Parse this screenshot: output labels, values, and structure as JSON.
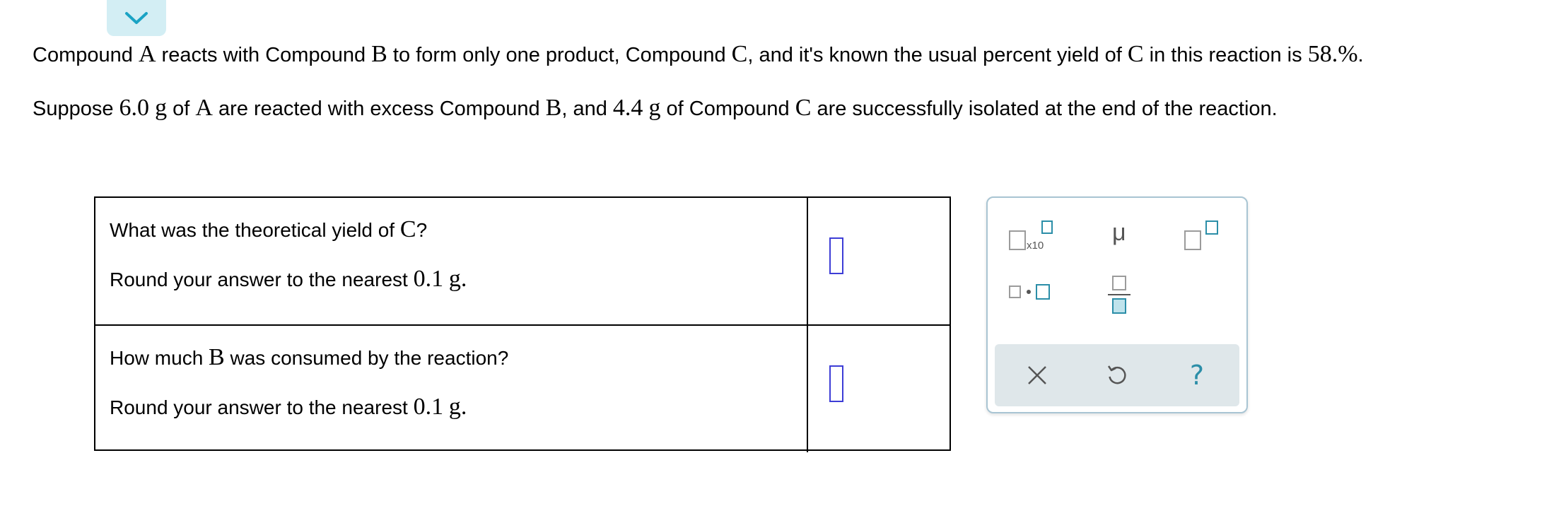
{
  "collapse_icon": "chevron-down-icon",
  "intro": {
    "line1": {
      "p1": "Compound ",
      "A": "A",
      "p2": " reacts with Compound ",
      "B": "B",
      "p3": " to form only one product, Compound ",
      "C": "C",
      "p4": ", and it's known the usual percent yield of ",
      "C2": "C",
      "p5": " in this reaction is ",
      "yield": "58.%",
      "p6": "."
    },
    "line2": {
      "p1": "Suppose ",
      "massA": "6.0",
      "unit1": "g",
      "p2": " of ",
      "A": "A",
      "p3": " are reacted with excess Compound ",
      "B": "B",
      "p4": ", and ",
      "massC": "4.4",
      "unit2": "g",
      "p5": " of Compound ",
      "C": "C",
      "p6": " are successfully isolated at the end of the reaction."
    }
  },
  "questions": [
    {
      "q_pre": "What was the theoretical yield of ",
      "q_var": "C",
      "q_post": "?",
      "r_pre": "Round your answer to the nearest ",
      "r_val": "0.1",
      "r_unit": "g."
    },
    {
      "q_pre": "How much ",
      "q_var": "B",
      "q_post": " was consumed by the reaction?",
      "r_pre": "Round your answer to the nearest ",
      "r_val": "0.1",
      "r_unit": "g."
    }
  ],
  "palette": {
    "x10_label": "x10",
    "mu_label": "μ",
    "tools": [
      "times-ten-power-icon",
      "micro-symbol-icon",
      "superscript-icon",
      "multiply-dot-icon",
      "fraction-icon"
    ],
    "actions": [
      "clear-icon",
      "undo-icon",
      "help-icon"
    ],
    "help_label": "?"
  },
  "colors": {
    "accent": "#2b8ea8",
    "answer_border": "#3d3dd6",
    "action_bar": "#dfe7ea",
    "tab_bg": "#d3eef4"
  }
}
